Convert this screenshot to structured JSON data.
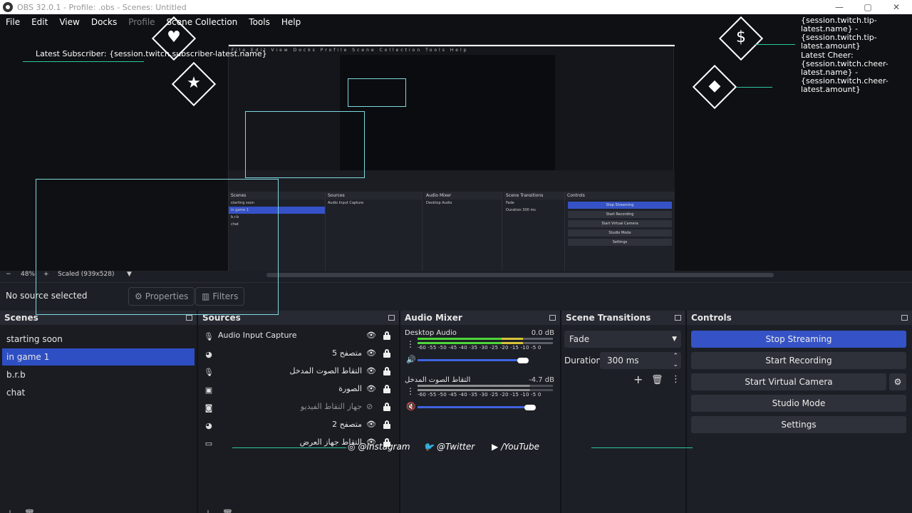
{
  "window": {
    "title": "OBS 32.0.1 - Profile: .obs - Scenes: Untitled",
    "icon": "obs-icon"
  },
  "menu": [
    {
      "label": "File",
      "dim": false
    },
    {
      "label": "Edit",
      "dim": false
    },
    {
      "label": "View",
      "dim": false
    },
    {
      "label": "Docks",
      "dim": false
    },
    {
      "label": "Profile",
      "dim": true
    },
    {
      "label": "Scene Collection",
      "dim": false
    },
    {
      "label": "Tools",
      "dim": false
    },
    {
      "label": "Help",
      "dim": false
    }
  ],
  "overlay": {
    "latest_subscriber": "Latest Subscriber: {session.twitch.subscriber-latest.name}",
    "tip_lines": "{session.twitch.tip-\nlatest.name} -\n{session.twitch.tip-\nlatest.amount}",
    "cheer_lines": "Latest Cheer:\n{session.twitch.cheer-\nlatest.name} -\n{session.twitch.cheer-\nlatest.amount}",
    "diamond_icons": [
      "heart-icon",
      "star-icon",
      "dollar-icon",
      "gem-icon"
    ]
  },
  "preview_bar": {
    "zoom_minus": "−",
    "zoom": "48%",
    "zoom_plus": "+",
    "scaled": "Scaled (939x528)"
  },
  "properties_bar": {
    "status": "No source selected",
    "properties": "Properties",
    "filters": "Filters"
  },
  "docks": {
    "scenes": {
      "title": "Scenes",
      "items": [
        "starting soon",
        "in game 1",
        "b.r.b",
        "chat"
      ],
      "selected_index": 1
    },
    "sources": {
      "title": "Sources",
      "items": [
        {
          "name": "Audio Input Capture",
          "icon": "microphone-icon",
          "visible": true
        },
        {
          "name": "متصفح 5",
          "icon": "globe-icon",
          "visible": true
        },
        {
          "name": "التقاط الصوت المدخل",
          "icon": "microphone-icon",
          "visible": true
        },
        {
          "name": "الصورة",
          "icon": "image-icon",
          "visible": true
        },
        {
          "name": "جهاز التقاط الفيديو",
          "icon": "camera-icon",
          "visible": false
        },
        {
          "name": "متصفح 2",
          "icon": "globe-icon",
          "visible": true
        },
        {
          "name": "التقاط جهاز العرض",
          "icon": "monitor-icon",
          "visible": true
        }
      ]
    },
    "audio_mixer": {
      "title": "Audio Mixer",
      "channels": [
        {
          "name": "Desktop Audio",
          "db": "0.0 dB",
          "scale": "-60 -55 -50 -45 -40 -35 -30 -25 -20 -15 -10 -5 0",
          "level": 0.78,
          "muted": false
        },
        {
          "name": "التقاط الصوت المدخل",
          "db": "-4.7 dB",
          "scale": "-60 -55 -50 -45 -40 -35 -30 -25 -20 -15 -10 -5 0",
          "level": 0.83,
          "muted": true
        }
      ]
    },
    "scene_transitions": {
      "title": "Scene Transitions",
      "transition": "Fade",
      "duration_label": "Duration",
      "duration": "300 ms"
    },
    "controls": {
      "title": "Controls",
      "buttons": [
        "Stop Streaming",
        "Start Recording",
        "Start Virtual Camera",
        "Studio Mode",
        "Settings"
      ]
    }
  },
  "socials": [
    {
      "icon": "instagram-icon",
      "label": "@Instagram"
    },
    {
      "icon": "twitter-icon",
      "label": "@Twitter"
    },
    {
      "icon": "youtube-icon",
      "label": "/YouTube"
    }
  ],
  "colors": {
    "accent": "#3553c6",
    "selection": "#2e4fc4",
    "meter_green": "#4fd43a",
    "meter_yellow": "#d6c43a",
    "meter_red": "#d63a3a",
    "overlay_line": "#2bc9a0"
  }
}
